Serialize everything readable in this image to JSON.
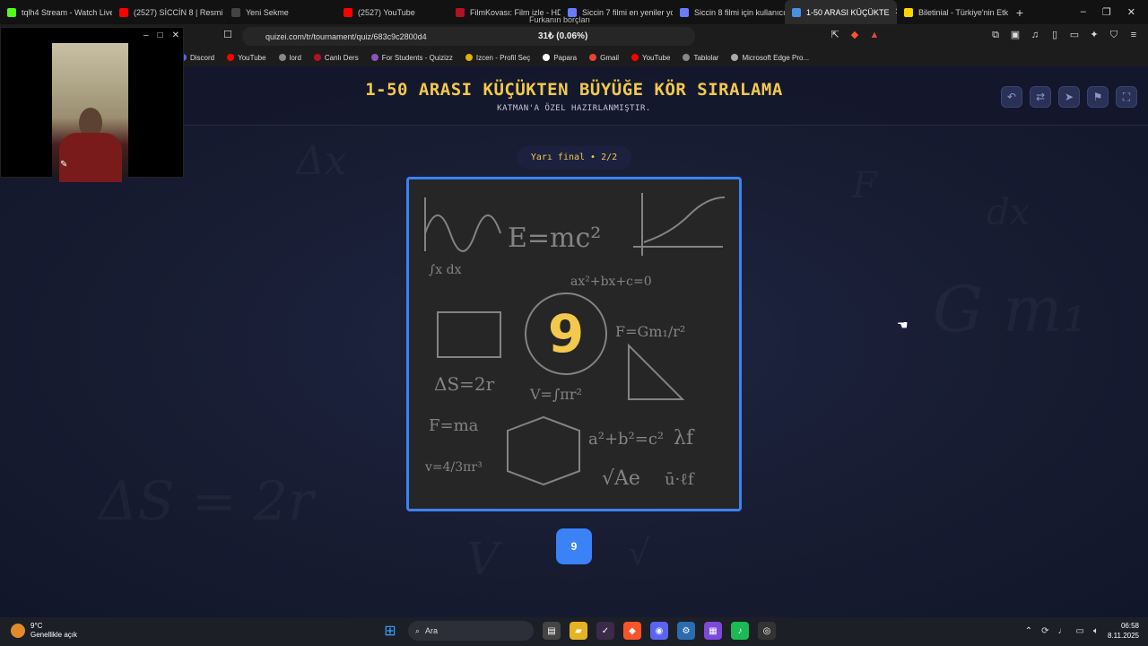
{
  "browser": {
    "tabs": [
      {
        "label": "tqlh4 Stream - Watch Live",
        "color": "#53fc18"
      },
      {
        "label": "(2527) SİCCİN 8 | Resmi Fr",
        "color": "#ff0000"
      },
      {
        "label": "Yeni Sekme",
        "color": "#444444"
      },
      {
        "label": "(2527) YouTube",
        "color": "#ff0000"
      },
      {
        "label": "FilmKovası: Film izle - HD",
        "color": "#b11226"
      },
      {
        "label": "Siccin 7 filmi en yeniler yo",
        "color": "#6a7bff"
      },
      {
        "label": "Siccin 8 filmi için kullanıcı",
        "color": "#6a7bff"
      },
      {
        "label": "1-50 ARASI KÜÇÜKTE",
        "color": "#4a90e2"
      },
      {
        "label": "Biletinial - Türkiye'nin Etk",
        "color": "#ffd400"
      }
    ],
    "url": "quizei.com/tr/tournament/quiz/683c9c2800d4",
    "overlay_rate": "31₺ (0.06%)",
    "overlay_name": "Furkanın borçları",
    "bookmarks": [
      {
        "label": "Discord",
        "color": "#5865f2"
      },
      {
        "label": "YouTube",
        "color": "#ff0000"
      },
      {
        "label": "lord",
        "color": "#888888"
      },
      {
        "label": "Canlı Ders",
        "color": "#b11226"
      },
      {
        "label": "For Students - Quizizz",
        "color": "#8854c0"
      },
      {
        "label": "Izcen - Profil Seç",
        "color": "#e0b000"
      },
      {
        "label": "Papara",
        "color": "#ffffff"
      },
      {
        "label": "Gmail",
        "color": "#ea4335"
      },
      {
        "label": "YouTube",
        "color": "#ff0000"
      },
      {
        "label": "Tablolar",
        "color": "#888888"
      },
      {
        "label": "Microsoft Edge Pro...",
        "color": "#aaaaaa"
      }
    ]
  },
  "quiz": {
    "title": "1-50 ARASI KÜÇÜKTEN BÜYÜĞE KÖR SIRALAMA",
    "subtitle": "KATMAN'A ÖZEL HAZIRLANMIŞTIR.",
    "round_label": "Yarı final • 2/2",
    "card_number": "9",
    "answer_label": "9",
    "accent_color": "#f2c94c",
    "highlight_color": "#3b82f6"
  },
  "chalkboard": {
    "formulas": [
      "E=mc²",
      "ax²+bx+c=0",
      "∫x dx",
      "ΔS=2r",
      "V=∫πr²",
      "F=ma",
      "a²+b²=c²",
      "λf",
      "√Ae",
      "ū·ℓf",
      "F=Gm₁/r²",
      "v=4/3πr³"
    ]
  },
  "background_formulas": [
    "Δx",
    "F",
    "dx",
    "G m₁",
    "ΔS = 2r",
    "V",
    "√"
  ],
  "taskbar": {
    "weather_temp": "9°C",
    "weather_desc": "Genellikle açık",
    "search_label": "Ara",
    "time": "06:58",
    "date": "8.11.2025"
  }
}
